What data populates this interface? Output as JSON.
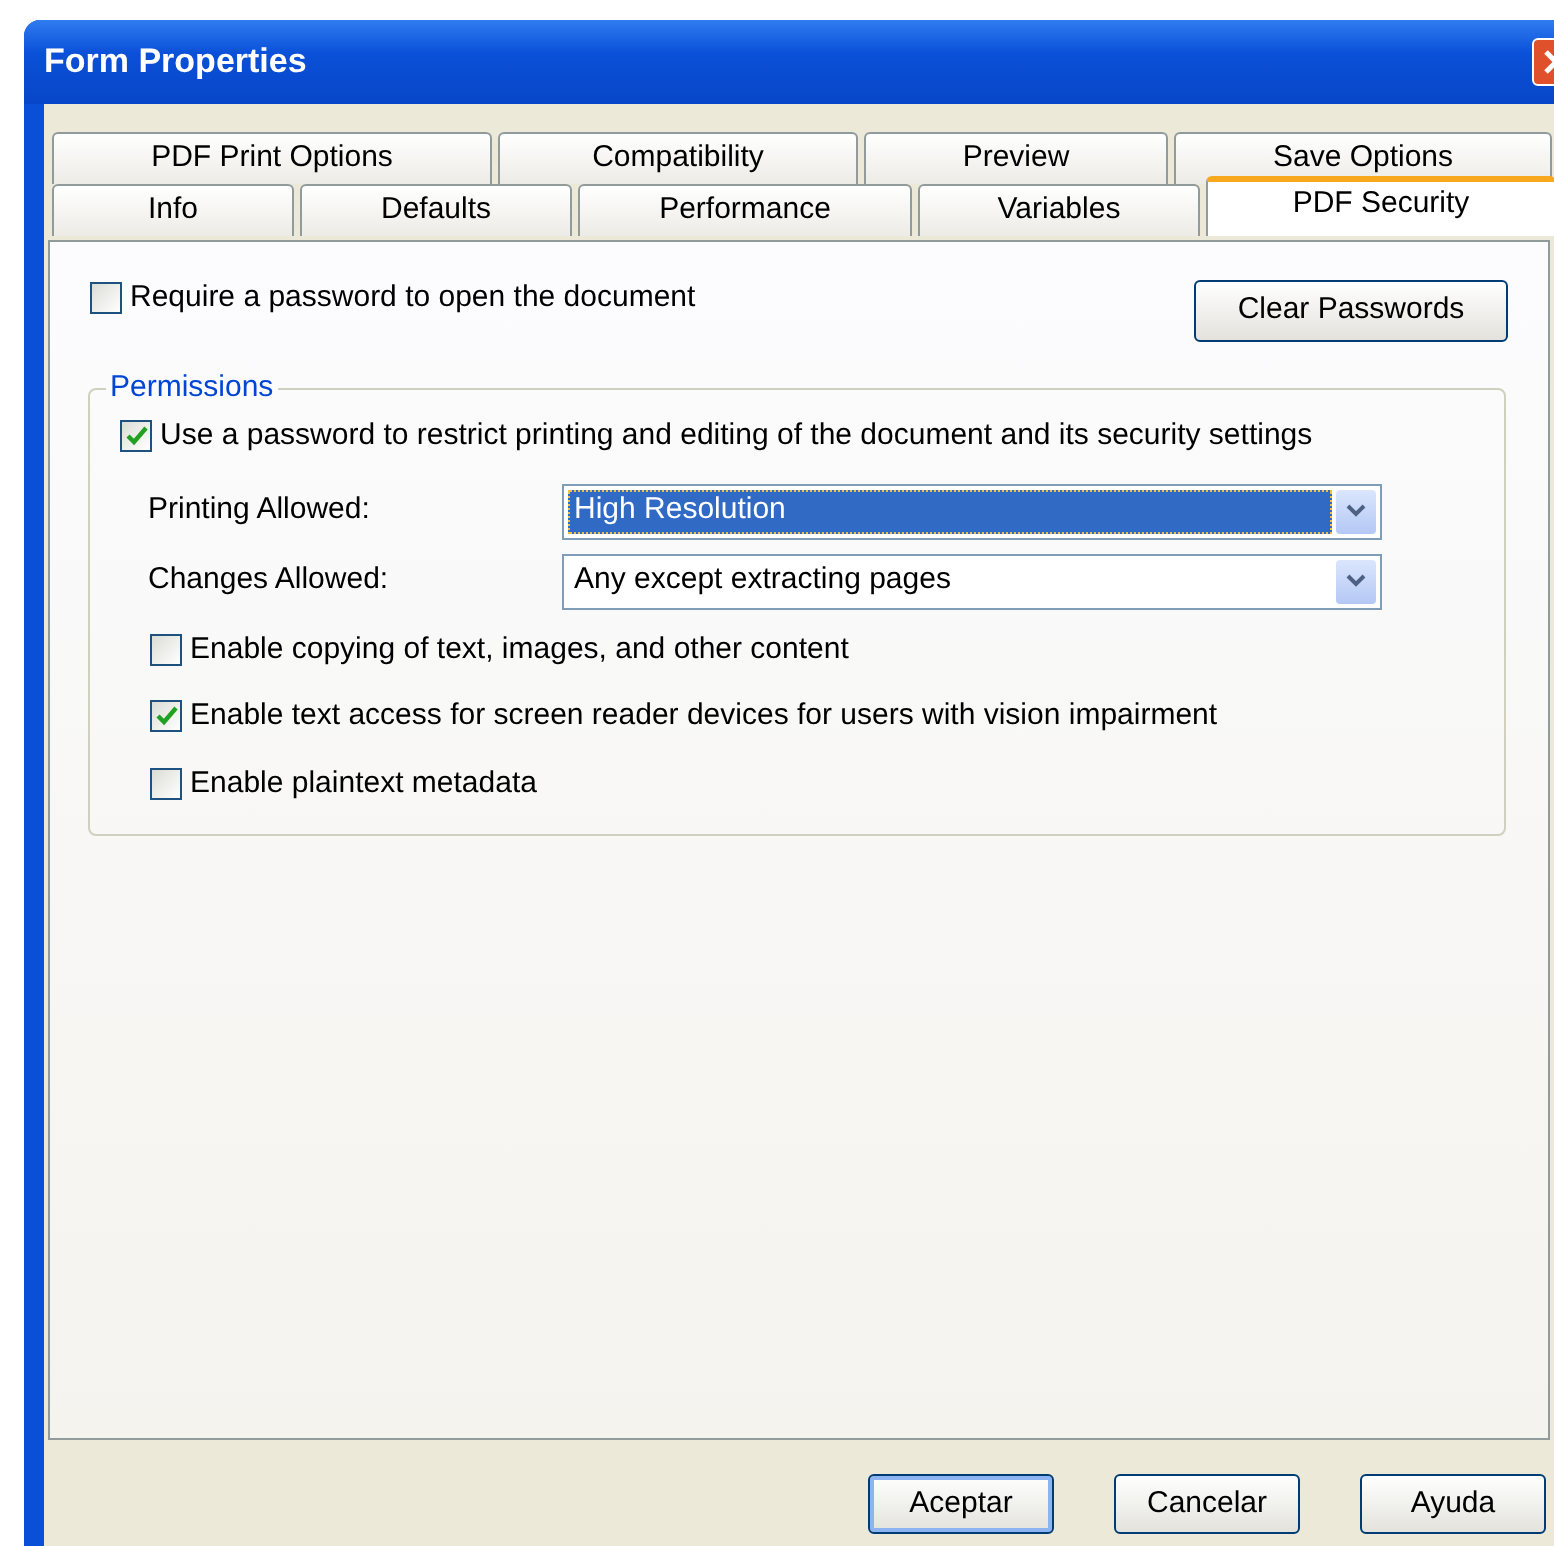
{
  "window": {
    "title": "Form Properties"
  },
  "tab_rows": [
    {
      "tabs": [
        {
          "label": "PDF Print Options",
          "selected": false
        },
        {
          "label": "Compatibility",
          "selected": false
        },
        {
          "label": "Preview",
          "selected": false
        },
        {
          "label": "Save Options",
          "selected": false
        }
      ]
    },
    {
      "tabs": [
        {
          "label": "Info",
          "selected": false
        },
        {
          "label": "Defaults",
          "selected": false
        },
        {
          "label": "Performance",
          "selected": false
        },
        {
          "label": "Variables",
          "selected": false
        },
        {
          "label": "PDF Security",
          "selected": true
        }
      ]
    }
  ],
  "require_password": {
    "label": "Require a password to open the document",
    "checked": false
  },
  "clear_button": "Clear Passwords",
  "permissions": {
    "legend": "Permissions",
    "use_password": {
      "label": "Use a password to restrict printing and editing of the document and its security settings",
      "checked": true
    },
    "dropdowns": [
      {
        "label": "Printing Allowed:",
        "value": "High Resolution",
        "focused": true
      },
      {
        "label": "Changes Allowed:",
        "value": "Any except extracting pages",
        "focused": false
      }
    ],
    "options": [
      {
        "label": "Enable copying of text, images, and other content",
        "checked": false
      },
      {
        "label": "Enable text access for screen reader devices for users with vision impairment",
        "checked": true
      },
      {
        "label": "Enable plaintext metadata",
        "checked": false
      }
    ]
  },
  "buttons": [
    {
      "label": "Aceptar",
      "default": true
    },
    {
      "label": "Cancelar",
      "default": false
    },
    {
      "label": "Ayuda",
      "default": false
    }
  ]
}
